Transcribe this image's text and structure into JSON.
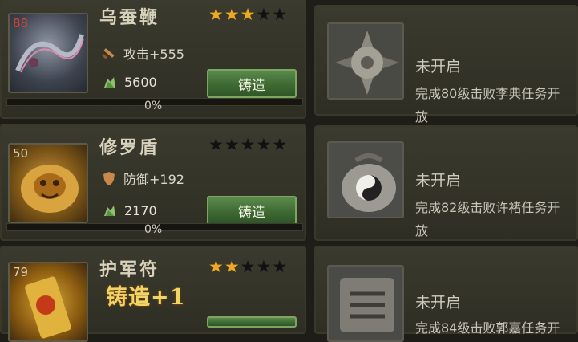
{
  "equipment": [
    {
      "level": "88",
      "level_color": "#e0442e",
      "name": "乌蚕鞭",
      "stars_filled": 3,
      "stars_total": 5,
      "stat": "攻击+555",
      "stat_icon": "sword-icon",
      "cost": "5600",
      "cost_icon": "ore-icon",
      "button": "铸造",
      "progress": "0%",
      "progress_value": 0
    },
    {
      "level": "50",
      "level_color": "#d6d0c0",
      "name": "修罗盾",
      "stars_filled": 0,
      "stars_total": 5,
      "stat": "防御+192",
      "stat_icon": "shield-icon",
      "cost": "2170",
      "cost_icon": "ore-icon",
      "button": "铸造",
      "progress": "0%",
      "progress_value": 0
    },
    {
      "level": "79",
      "level_color": "#d6d0c0",
      "name": "护军符",
      "stars_filled": 2,
      "stars_total": 5
    }
  ],
  "locked": [
    {
      "status": "未开启",
      "desc_line1": "完成80级击败李典任务开",
      "desc_line2": "放",
      "icon": "compass-icon"
    },
    {
      "status": "未开启",
      "desc_line1": "完成82级击败许褚任务开",
      "desc_line2": "放",
      "icon": "yinyang-pouch-icon"
    },
    {
      "status": "未开启",
      "desc_line1": "完成84级击败郭嘉任务开",
      "icon": "scroll-seal-icon"
    }
  ],
  "overlay_text": "铸造+1",
  "colors": {
    "star_on": "#f0a820",
    "star_off": "#111111",
    "button_green": "#4a7a3e"
  }
}
